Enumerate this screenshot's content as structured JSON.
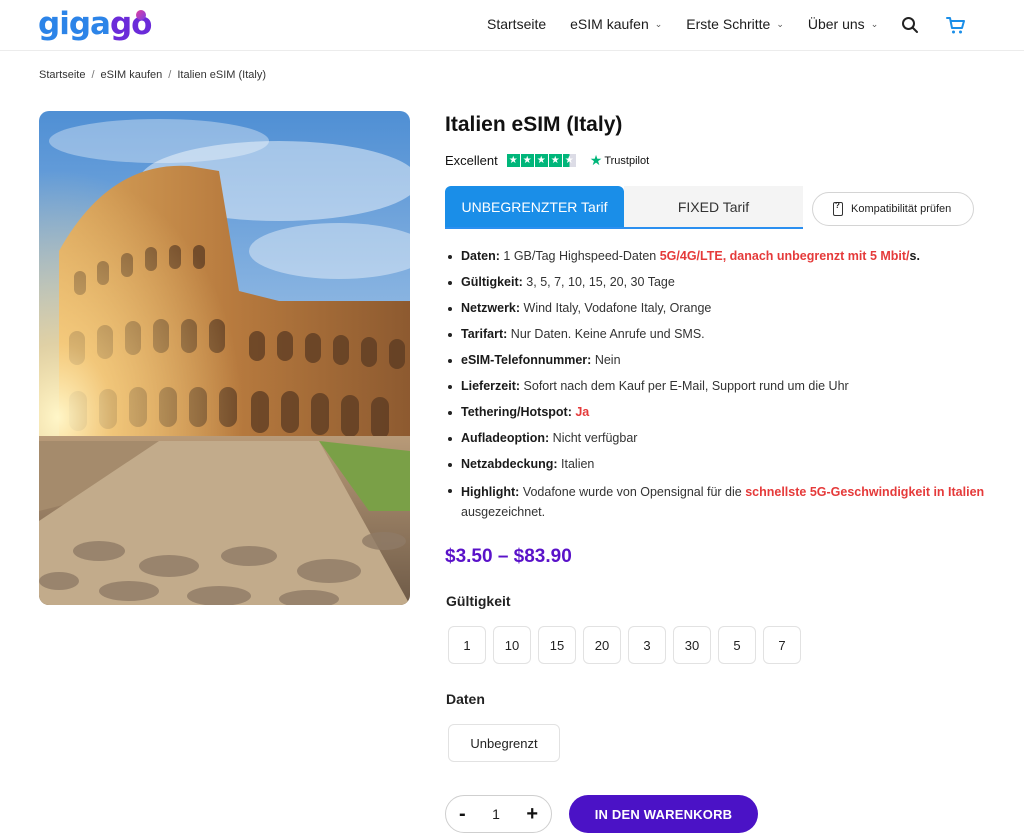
{
  "brand": {
    "logo_text": "gigago"
  },
  "nav": {
    "items": [
      {
        "label": "Startseite",
        "has_dropdown": false
      },
      {
        "label": "eSIM kaufen",
        "has_dropdown": true
      },
      {
        "label": "Erste Schritte",
        "has_dropdown": true
      },
      {
        "label": "Über uns",
        "has_dropdown": true
      }
    ],
    "search_icon": "search-icon",
    "cart_icon": "cart-icon"
  },
  "breadcrumb": [
    "Startseite",
    "eSIM kaufen",
    "Italien eSIM (Italy)"
  ],
  "product": {
    "title": "Italien eSIM (Italy)",
    "rating_label": "Excellent",
    "rating_source": "Trustpilot",
    "rating_stars": 4.5,
    "tabs": [
      "UNBEGRENZTER Tarif",
      "FIXED Tarif"
    ],
    "active_tab": 0,
    "compat_button": "Kompatibilität prüfen",
    "features": [
      {
        "label": "Daten:",
        "text": "1 GB/Tag Highspeed-Daten ",
        "highlight": "5G/4G/LTE, danach unbegrenzt mit 5 Mbit/",
        "suffix": "s."
      },
      {
        "label": "Gültigkeit:",
        "text": "3, 5, 7, 10, 15, 20, 30 Tage"
      },
      {
        "label": "Netzwerk:",
        "text": "Wind Italy, Vodafone Italy, Orange"
      },
      {
        "label": "Tarifart:",
        "text": "Nur Daten. Keine Anrufe und SMS."
      },
      {
        "label": "eSIM-Telefonnummer:",
        "text": "Nein"
      },
      {
        "label": "Lieferzeit:",
        "text": "Sofort nach dem Kauf per E-Mail, Support rund um die Uhr"
      },
      {
        "label": "Tethering/Hotspot:",
        "text": "",
        "highlight": "Ja"
      },
      {
        "label": "Aufladeoption:",
        "text": "Nicht verfügbar"
      },
      {
        "label": "Netzabdeckung:",
        "text": "Italien"
      },
      {
        "label": "Highlight:",
        "text": "Vodafone wurde von Opensignal für die ",
        "highlight": "schnellste 5G-Geschwindigkeit in Italien",
        "suffix": " ausgezeichnet."
      }
    ],
    "price": "$3.50 – $83.90",
    "validity_label": "Gültigkeit",
    "validity_options": [
      "1",
      "10",
      "15",
      "20",
      "3",
      "30",
      "5",
      "7"
    ],
    "data_label": "Daten",
    "data_options": [
      "Unbegrenzt"
    ],
    "quantity": "1",
    "qty_minus": "-",
    "qty_plus": "+",
    "add_to_cart": "IN DEN WARENKORB"
  },
  "colors": {
    "brand_blue": "#2c84e8",
    "brand_purple": "#4b12c6",
    "price_purple": "#5a12c9",
    "tab_blue": "#1a8ee8",
    "highlight_red": "#e53a3a",
    "trustpilot_green": "#00b67a"
  }
}
